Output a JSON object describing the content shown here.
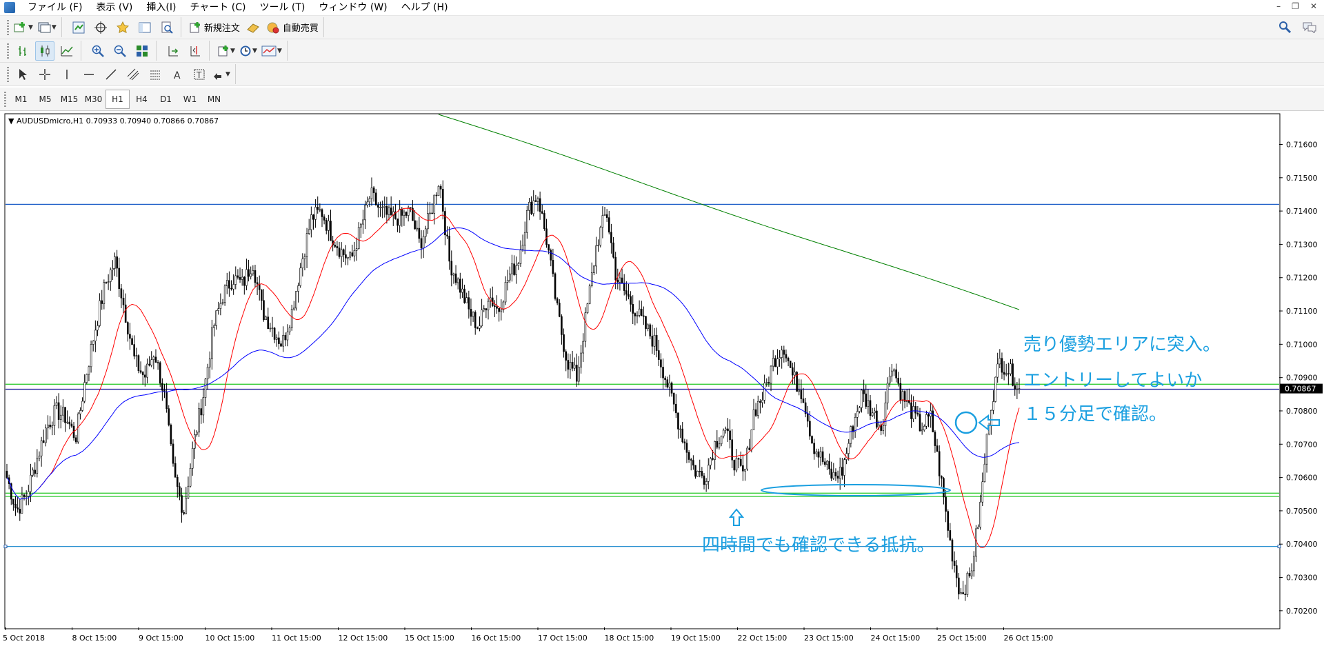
{
  "menu": {
    "items": [
      "ファイル (F)",
      "表示 (V)",
      "挿入(I)",
      "チャート (C)",
      "ツール (T)",
      "ウィンドウ (W)",
      "ヘルプ (H)"
    ]
  },
  "toolbar": {
    "new_order_label": "新規注文",
    "auto_trade_label": "自動売買"
  },
  "periods": [
    "M1",
    "M5",
    "M15",
    "M30",
    "H1",
    "H4",
    "D1",
    "W1",
    "MN"
  ],
  "active_period": "H1",
  "chart": {
    "header": "AUDUSDmicro,H1  0.70933 0.70940 0.70866 0.70867",
    "current_price": "0.70867",
    "price_ticks": [
      "0.71600",
      "0.71500",
      "0.71400",
      "0.71300",
      "0.71200",
      "0.71100",
      "0.71000",
      "0.70900",
      "0.70800",
      "0.70700",
      "0.70600",
      "0.70500",
      "0.70400",
      "0.70300",
      "0.70200"
    ],
    "date_ticks": [
      "5 Oct 2018",
      "8 Oct 15:00",
      "9 Oct 15:00",
      "10 Oct 15:00",
      "11 Oct 15:00",
      "12 Oct 15:00",
      "15 Oct 15:00",
      "16 Oct 15:00",
      "17 Oct 15:00",
      "18 Oct 15:00",
      "19 Oct 15:00",
      "22 Oct 15:00",
      "23 Oct 15:00",
      "24 Oct 15:00",
      "25 Oct 15:00",
      "26 Oct 15:00"
    ],
    "colors": {
      "candle": "#000000",
      "ma_fast": "#ff0000",
      "ma_mid": "#0000ff",
      "ma_slow": "#008000",
      "resistance_line": "#1f5fc8",
      "support_line": "#33cc33",
      "annotation": "#1a9fe0"
    }
  },
  "chart_data": {
    "type": "candlestick",
    "symbol": "AUDUSDmicro",
    "timeframe": "H1",
    "ohlc_current": {
      "open": 0.70933,
      "high": 0.7094,
      "low": 0.70866,
      "close": 0.70867
    },
    "ylim": [
      0.7015,
      0.7169
    ],
    "horizontal_lines": [
      0.7142,
      0.7088,
      0.70865,
      0.70553,
      0.70543,
      0.70393
    ],
    "close_path": [
      0.706,
      0.705,
      0.7055,
      0.7065,
      0.7075,
      0.708,
      0.7078,
      0.7072,
      0.709,
      0.7105,
      0.7118,
      0.7125,
      0.711,
      0.7095,
      0.709,
      0.7098,
      0.7085,
      0.706,
      0.705,
      0.707,
      0.7085,
      0.7105,
      0.7115,
      0.712,
      0.7118,
      0.7125,
      0.711,
      0.7105,
      0.71,
      0.711,
      0.7125,
      0.7138,
      0.714,
      0.7133,
      0.7128,
      0.7125,
      0.7135,
      0.7145,
      0.714,
      0.7138,
      0.7138,
      0.714,
      0.713,
      0.7138,
      0.715,
      0.7125,
      0.7118,
      0.711,
      0.7105,
      0.7115,
      0.711,
      0.712,
      0.7125,
      0.714,
      0.7145,
      0.713,
      0.711,
      0.7095,
      0.709,
      0.711,
      0.713,
      0.714,
      0.712,
      0.7115,
      0.711,
      0.7105,
      0.71,
      0.709,
      0.708,
      0.707,
      0.7062,
      0.706,
      0.707,
      0.7075,
      0.7065,
      0.706,
      0.708,
      0.7085,
      0.7095,
      0.71,
      0.709,
      0.7085,
      0.707,
      0.7065,
      0.706,
      0.7062,
      0.7075,
      0.7085,
      0.708,
      0.7075,
      0.7095,
      0.7085,
      0.708,
      0.7075,
      0.7078,
      0.706,
      0.704,
      0.7025,
      0.703,
      0.705,
      0.708,
      0.7095,
      0.7092,
      0.7087
    ]
  },
  "annotations": {
    "entry_title": "売り優勢エリアに突入。",
    "entry_line2": "エントリーしてよいか",
    "entry_line3": "１５分足で確認。",
    "support_note": "四時間でも確認できる抵抗。"
  }
}
